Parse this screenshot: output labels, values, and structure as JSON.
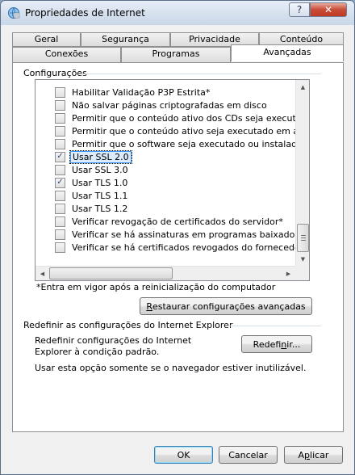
{
  "window": {
    "title": "Propriedades de Internet",
    "help_label": "?",
    "close_label": "✕",
    "accent": "#3399ff"
  },
  "tabs_row1": [
    {
      "label": "Geral"
    },
    {
      "label": "Segurança"
    },
    {
      "label": "Privacidade"
    },
    {
      "label": "Conteúdo"
    }
  ],
  "tabs_row2": [
    {
      "label": "Conexões"
    },
    {
      "label": "Programas"
    },
    {
      "label": "Avançadas",
      "active": true
    }
  ],
  "settings": {
    "group_label": "Configurações",
    "items": [
      {
        "label": "Habilitar Validação P3P Estrita*",
        "checked": false
      },
      {
        "label": "Não salvar páginas criptografadas em disco",
        "checked": false
      },
      {
        "label": "Permitir que o conteúdo ativo dos CDs seja executado no",
        "checked": false
      },
      {
        "label": "Permitir que o conteúdo ativo seja executado em arquivos",
        "checked": false
      },
      {
        "label": "Permitir que o software seja executado ou instalado mesm",
        "checked": false
      },
      {
        "label": "Usar SSL 2.0",
        "checked": true,
        "selected": true
      },
      {
        "label": "Usar SSL 3.0",
        "checked": false
      },
      {
        "label": "Usar TLS 1.0",
        "checked": true
      },
      {
        "label": "Usar TLS 1.1",
        "checked": false
      },
      {
        "label": "Usar TLS 1.2",
        "checked": false
      },
      {
        "label": "Verificar revogação de certificados do servidor*",
        "checked": false
      },
      {
        "label": "Verificar se há assinaturas em programas baixados",
        "checked": false
      },
      {
        "label": "Verificar se há certificados revogados do fornecedor",
        "checked": false
      }
    ],
    "note": "*Entra em vigor após a reinicialização do computador",
    "restore_button": {
      "underline": "R",
      "rest": "estaurar configurações avançadas"
    }
  },
  "reset": {
    "group_label": "Redefinir as configurações do Internet Explorer",
    "description": "Redefinir configurações do Internet Explorer à condição padrão.",
    "button": {
      "before": "Redefi",
      "underline": "n",
      "after": "ir..."
    },
    "note": "Usar esta opção somente se o navegador estiver inutilizável."
  },
  "footer": {
    "ok_label": "OK",
    "cancel_label": "Cancelar",
    "apply": {
      "before": "A",
      "underline": "p",
      "after": "licar"
    }
  }
}
